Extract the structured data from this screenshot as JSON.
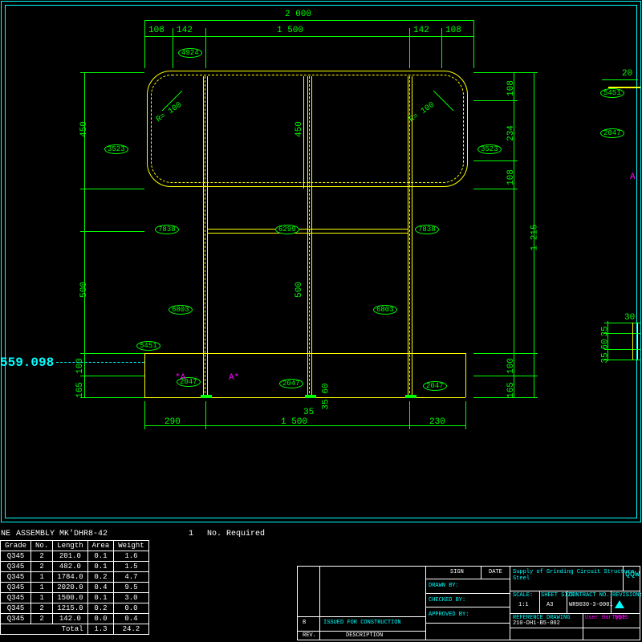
{
  "dims": {
    "top_2000": "2 000",
    "top_108_l": "108",
    "top_142_l": "142",
    "top_1500": "1 500",
    "top_142_r": "142",
    "top_108_r": "108",
    "right_108_t": "108",
    "right_234": "234",
    "right_108_b": "108",
    "right_1215": "1 215",
    "right_165": "165",
    "right_100": "100",
    "left_450": "450",
    "left_500": "500",
    "left_165": "165",
    "left_100": "100",
    "mid_450": "450",
    "mid_500": "500",
    "bot_290": "290",
    "bot_1500": "1 500",
    "bot_230": "230",
    "bot_60": "60",
    "bot_35_1": "35",
    "bot_35_2": "35",
    "r100_l": "R= 100",
    "r100_r": "R= 100",
    "side_20": "20",
    "side_30": "30",
    "side_35_1": "35",
    "side_60": "60",
    "side_35_2": "35"
  },
  "bubbles": {
    "b4924": "4924",
    "b3523_l": "3523",
    "b3523_r": "3523",
    "b7838_l": "7838",
    "b6299": "6299",
    "b7838_r": "7838",
    "b6803_l": "6803",
    "b6803_r": "6803",
    "b5451_l": "5451",
    "b2047_l": "2047",
    "b2047_m": "2047",
    "b2047_r": "2047",
    "b5451_s": "5451",
    "b2047_s": "2047"
  },
  "coord": "559.098",
  "markers": {
    "a_left": "*A",
    "a_right": "A*",
    "a_side": "A"
  },
  "assembly": {
    "title": "ASSEMBLY MK'DHR8-42",
    "one": "1",
    "req": "No. Required",
    "ne": "NE",
    "headers": [
      "Grade",
      "No.",
      "Length",
      "Area",
      "Weight"
    ],
    "rows": [
      [
        "Q345",
        "2",
        "201.0",
        "0.1",
        "1.6"
      ],
      [
        "Q345",
        "2",
        "482.0",
        "0.1",
        "1.5"
      ],
      [
        "Q345",
        "1",
        "1784.0",
        "0.2",
        "4.7"
      ],
      [
        "Q345",
        "1",
        "2020.0",
        "0.4",
        "9.5"
      ],
      [
        "Q345",
        "1",
        "1500.0",
        "0.1",
        "3.0"
      ],
      [
        "Q345",
        "2",
        "1215.0",
        "0.2",
        "0.0"
      ],
      [
        "Q345",
        "2",
        "142.0",
        "0.0",
        "0.4"
      ]
    ],
    "total_label": "Total",
    "total_area": "1.3",
    "total_weight": "24.2"
  },
  "titleblock": {
    "drawn": "DRAWN BY:",
    "checked": "CHECKED BY:",
    "approved": "APPROVED BY:",
    "issued": "ISSUED FOR CONSTRUCTION",
    "rev": "REV.",
    "desc": "DESCRIPTION",
    "sign": "SIGN",
    "date": "DATE",
    "project": "Supply of Grinding Circuit Structure Steel",
    "scale": "SCALE:",
    "scale_v": "1:1",
    "sheet": "SHEET SIZE:",
    "sheet_v": "A3",
    "contract": "CONTRACT NO.:",
    "contract_v": "WR9030-3-0001",
    "revision": "REVISION:",
    "qqw": "QQW",
    "ref": "REFERENCE DRAWING",
    "ref_v": "210-DH1-B5-002",
    "bartype": "User BarType",
    "bartype_v": "BOIS",
    "b": "B"
  }
}
